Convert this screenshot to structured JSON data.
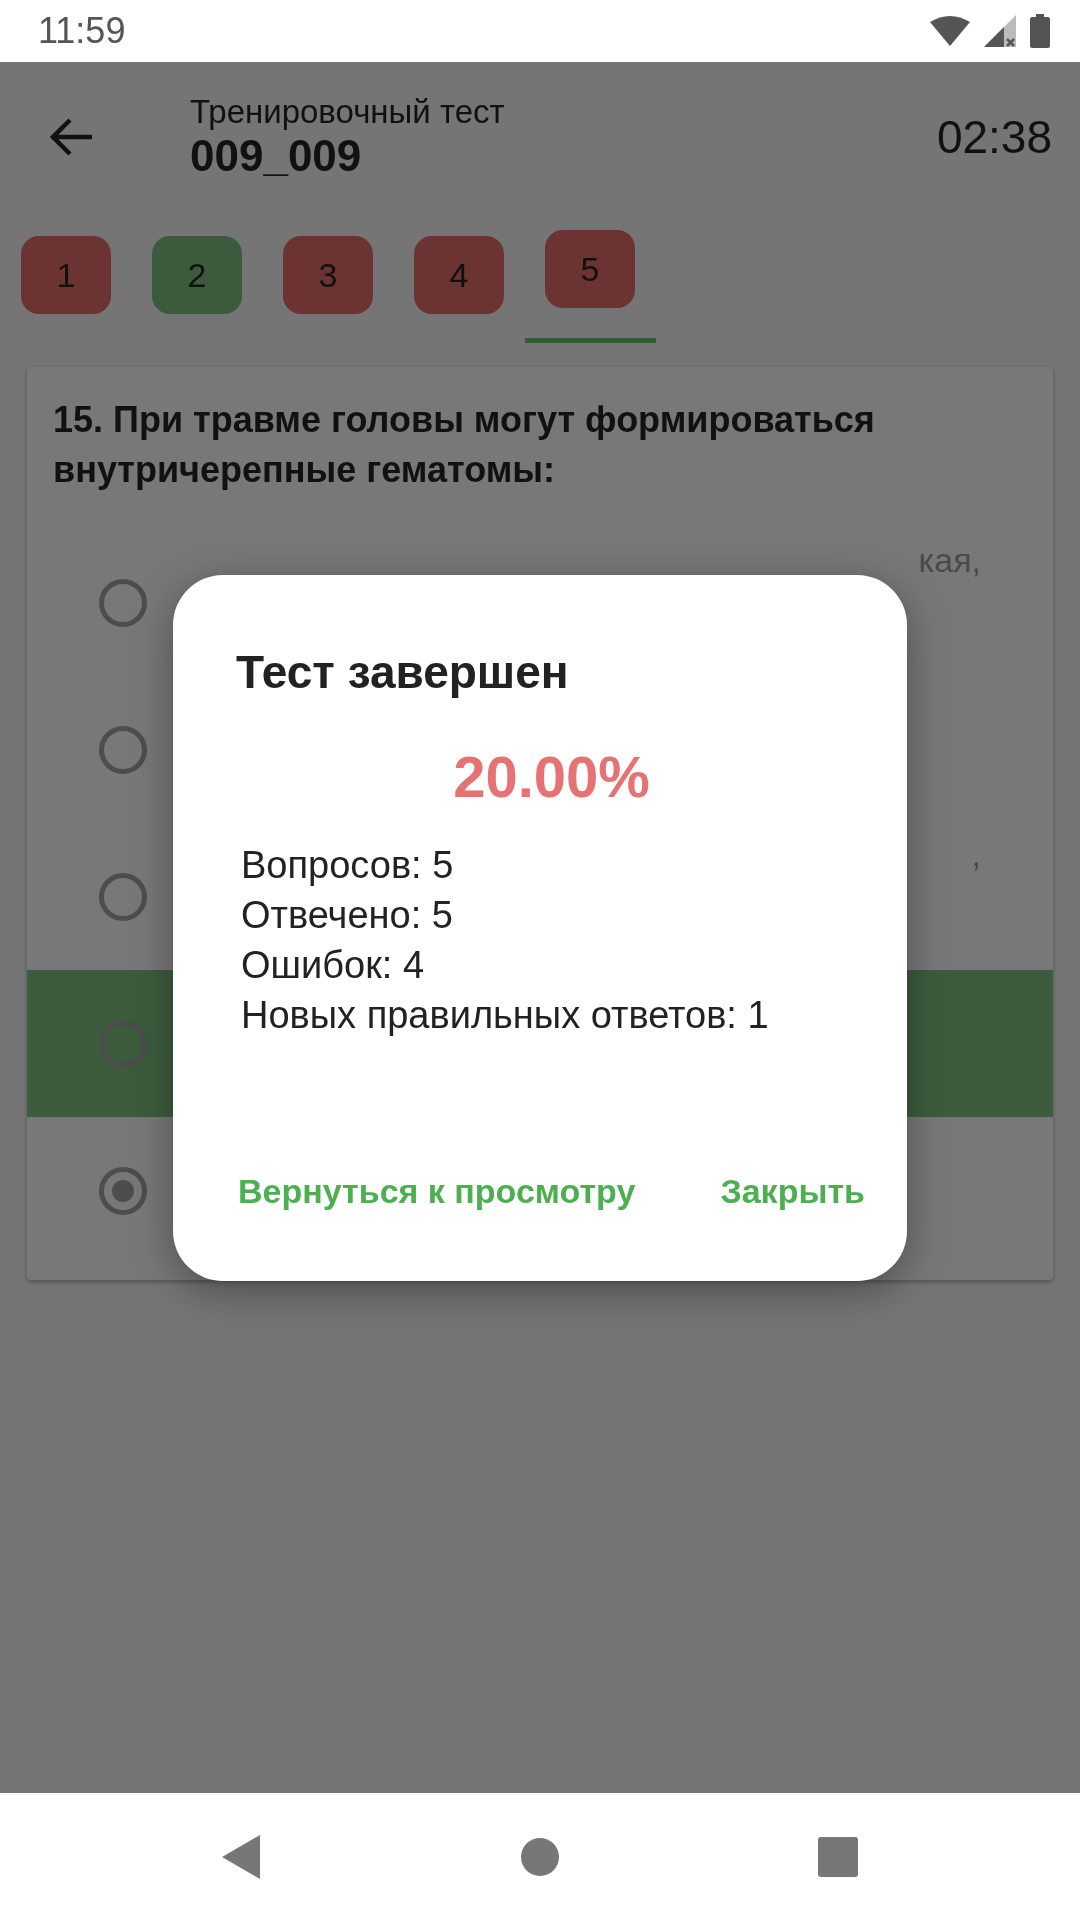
{
  "status_bar": {
    "time": "11:59"
  },
  "app_bar": {
    "subtitle": "Тренировочный тест",
    "title": "009_009",
    "timer": "02:38"
  },
  "tabs": [
    {
      "label": "1",
      "correct": false,
      "selected": false
    },
    {
      "label": "2",
      "correct": true,
      "selected": false
    },
    {
      "label": "3",
      "correct": false,
      "selected": false
    },
    {
      "label": "4",
      "correct": false,
      "selected": false
    },
    {
      "label": "5",
      "correct": false,
      "selected": true
    }
  ],
  "question": "15. При травме головы могут формироваться внутричерепные гематомы:",
  "options": [
    {
      "text": "кая,",
      "selected": false,
      "correct": false
    },
    {
      "selected": false,
      "correct": false
    },
    {
      "text": ",",
      "selected": false,
      "correct": false
    },
    {
      "selected": false,
      "correct": true
    },
    {
      "selected": true,
      "correct": false
    }
  ],
  "dialog": {
    "title": "Тест завершен",
    "score": "20.00%",
    "stats": [
      "Вопросов: 5",
      "Отвечено: 5",
      "Ошибок: 4",
      "Новых правильных ответов: 1"
    ],
    "buttons": [
      "Вернуться к просмотру",
      "Закрыть"
    ]
  }
}
